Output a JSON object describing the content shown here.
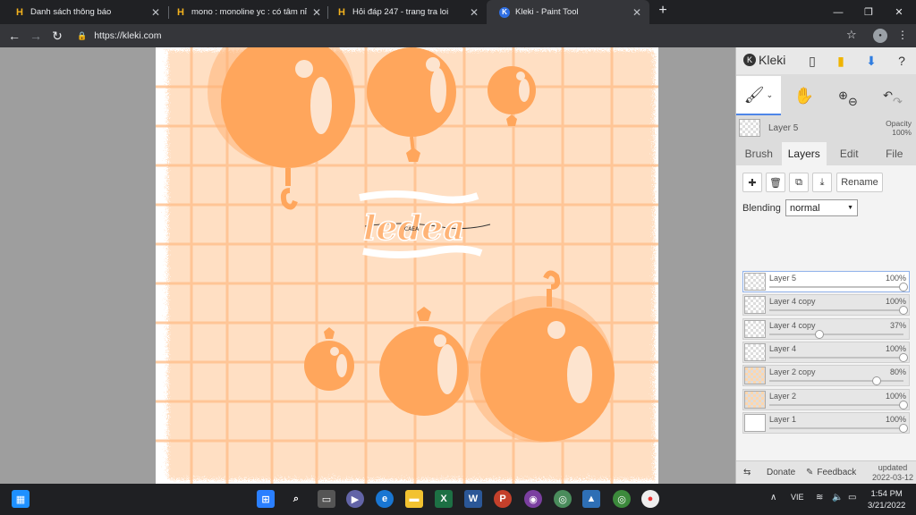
{
  "tabs": [
    {
      "title": "Danh sách thông báo",
      "icon": "h-logo-icon"
    },
    {
      "title": "mono : monoline yc : có tâm nỉ :",
      "icon": "h-logo-icon"
    },
    {
      "title": "Hỏi đáp 247 - trang tra loi",
      "icon": "h-logo-icon"
    },
    {
      "title": "Kleki - Paint Tool",
      "icon": "kleki-icon",
      "active": true
    }
  ],
  "address": {
    "url": "https://kleki.com"
  },
  "canvas": {
    "text_main": "ledea",
    "text_small": "CAEA"
  },
  "kleki": {
    "logo": "Kleki",
    "current_layer": "Layer 5",
    "opacity_label": "Opacity",
    "opacity_value": "100%",
    "tabs": [
      "Brush",
      "Layers",
      "Edit",
      "File"
    ],
    "rename_label": "Rename",
    "blending_label": "Blending",
    "blending_value": "normal",
    "layers": [
      {
        "name": "Layer 5",
        "opacity": "100%",
        "value": 1.0,
        "thumb": "transparent",
        "selected": true
      },
      {
        "name": "Layer 4 copy",
        "opacity": "100%",
        "value": 1.0,
        "thumb": "transparent"
      },
      {
        "name": "Layer 4 copy",
        "opacity": "37%",
        "value": 0.37,
        "thumb": "transparent"
      },
      {
        "name": "Layer 4",
        "opacity": "100%",
        "value": 1.0,
        "thumb": "transparent"
      },
      {
        "name": "Layer 2 copy",
        "opacity": "80%",
        "value": 0.8,
        "thumb": "orange"
      },
      {
        "name": "Layer 2",
        "opacity": "100%",
        "value": 1.0,
        "thumb": "orange"
      },
      {
        "name": "Layer 1",
        "opacity": "100%",
        "value": 1.0,
        "thumb": "white"
      }
    ],
    "footer": {
      "donate": "Donate",
      "feedback": "Feedback",
      "updated_label": "updated",
      "updated_date": "2022-03-12"
    }
  },
  "taskbar": {
    "lang": "VIE",
    "time": "1:54 PM",
    "date": "3/21/2022"
  },
  "colors": {
    "accent": "#4f86e8",
    "paint_orange": "#ffa65c",
    "paint_light": "#ffd9b8"
  }
}
